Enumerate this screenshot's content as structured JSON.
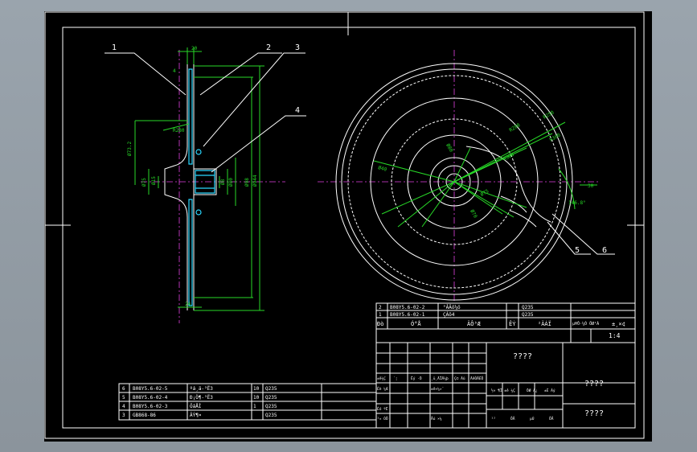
{
  "drawing": {
    "balloons": [
      "1",
      "2",
      "3",
      "4",
      "5",
      "6"
    ],
    "dims_left": [
      "20",
      "4",
      "R280",
      "Ø73.2",
      "Ø75",
      "Ø15",
      "Ø8",
      "Ø80",
      "Ø98",
      "Ø944",
      "24"
    ],
    "dims_right": [
      "R250",
      "R280",
      "R300",
      "R308",
      "Ø80",
      "Ø40",
      "Ø70",
      "Ø75",
      "146.8°",
      "30"
    ]
  },
  "title_block": {
    "parts": [
      {
        "no": "2",
        "code": "B08Y5.6-02-2",
        "name": "°ÂÂö¼ö",
        "mat": "Q235"
      },
      {
        "no": "1",
        "code": "B08Y5.6-02-1",
        "name": "ÇÀö4",
        "mat": "Q235"
      }
    ],
    "header": [
      "Ðò",
      "Ó°Å",
      "ÄÔ³Æ",
      "ÊÝ",
      "²ÄÁÏ",
      "µ¥Ô·¼Ó ÖØ¹Á",
      "±¸×¢"
    ],
    "placeholder_main": "????",
    "placeholder_right_top": "????",
    "placeholder_right_bottom": "????",
    "rev_header": [
      "±ê¼Ç",
      "´¦",
      "Êý ·Ö",
      "¸ü¸ÄÎÄ¼þ",
      "Ç© Ãû",
      "ÄêÔÂÈÕ"
    ],
    "rev_rows": [
      [
        "Éè ¼Æ",
        "",
        "",
        "±ê×¼»¯",
        "",
        ""
      ],
      [
        "Éó ºË",
        "",
        "",
        "",
        "",
        ""
      ],
      [
        "¹¤ ÒÕ",
        "",
        "",
        "Åú ×¼",
        "",
        ""
      ]
    ],
    "stage": [
      "½× ¶Î ±ê ¼Ç",
      "ÖØ Á¿",
      "±È Àý"
    ],
    "sheet": [
      "¹²",
      "ÕÅ",
      "µÚ",
      "ÕÅ"
    ],
    "ratio": "1:4"
  },
  "bom": [
    {
      "no": "6",
      "code": "B08Y5.6-02-5",
      "name": "ºá¸ä-³Ë3",
      "qty": "10",
      "mat": "Q235"
    },
    {
      "no": "5",
      "code": "B08Y5.6-02-4",
      "name": "Ð¡Ò¶-³Ë3",
      "qty": "10",
      "mat": "Q235"
    },
    {
      "no": "4",
      "code": "B08Y5.6-02-3",
      "name": "ÖáÅÌ",
      "qty": "1",
      "mat": "Q235"
    },
    {
      "no": "3",
      "code": "GB868-86",
      "name": "ÂÝ¶¤",
      "qty": "",
      "mat": "Q235"
    }
  ]
}
